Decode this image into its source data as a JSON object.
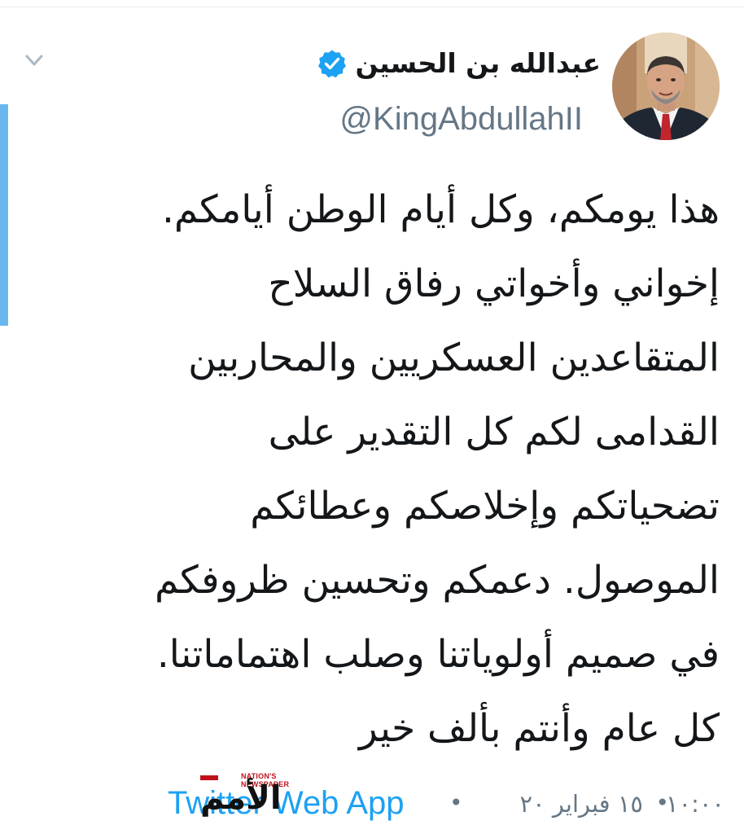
{
  "user": {
    "display_name": "عبدالله بن الحسين",
    "handle": "@KingAbdullahII",
    "verified": true
  },
  "tweet": {
    "lines": [
      "هذا يومكم، وكل أيام الوطن أيامكم.",
      "إخواني وأخواتي رفاق السلاح",
      "المتقاعدين العسكريين والمحاربين",
      "القدامى لكم كل التقدير على",
      "تضحياتكم وإخلاصكم وعطائكم",
      "الموصول. دعمكم وتحسين ظروفكم",
      "في صميم أولوياتنا وصلب اهتماماتنا.",
      "كل عام وأنتم بألف خير"
    ]
  },
  "meta": {
    "time": "١٠:٠٠",
    "separator": "•",
    "date": "١٥ فبراير ٢٠",
    "source": "Twitter Web App"
  },
  "watermark": {
    "arabic": "الأمم",
    "english": "NATION'S NEWSPAPER"
  },
  "colors": {
    "text": "#14171a",
    "secondary": "#657786",
    "link": "#1da1f2",
    "verified": "#1da1f2",
    "accent_bar": "#6ab7ef"
  },
  "icons": {
    "menu": "chevron-down-icon",
    "verified": "verified-badge-icon"
  }
}
